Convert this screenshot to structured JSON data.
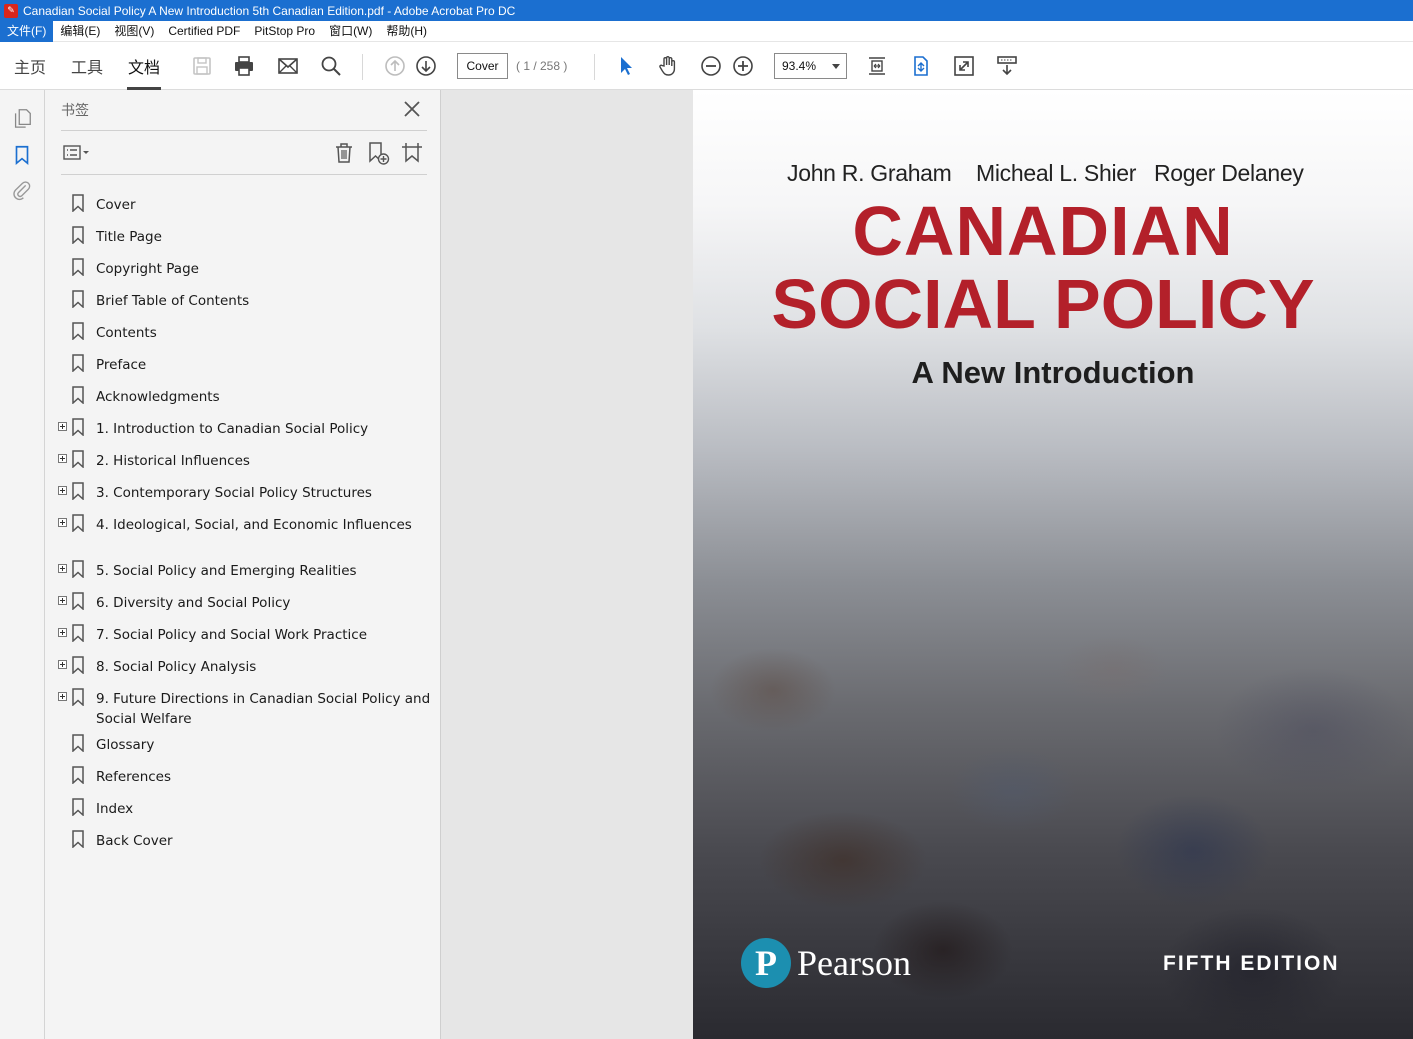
{
  "window": {
    "title": "Canadian Social Policy A New Introduction 5th Canadian Edition.pdf - Adobe Acrobat Pro DC",
    "app_icon": "pdf-icon"
  },
  "menubar": {
    "items": [
      "文件(F)",
      "编辑(E)",
      "视图(V)",
      "Certified PDF",
      "PitStop Pro",
      "窗口(W)",
      "帮助(H)"
    ]
  },
  "toolbar": {
    "tabs": [
      "主页",
      "工具",
      "文档"
    ],
    "selected_tab": "文档",
    "page_input": "Cover",
    "page_count": "( 1 / 258 )",
    "zoom": "93.4%",
    "icons": [
      "save-icon",
      "print-icon",
      "email-icon",
      "search-icon",
      "page-up-icon",
      "page-down-icon",
      "select-pointer-icon",
      "hand-tool-icon",
      "zoom-out-icon",
      "zoom-in-icon",
      "fit-page-icon",
      "scroll-mode-icon",
      "fullscreen-icon",
      "read-mode-icon"
    ]
  },
  "left_rail": {
    "icons": [
      "pages-icon",
      "bookmark-icon",
      "attachment-icon"
    ]
  },
  "bookmarks": {
    "header": "书签",
    "items": [
      {
        "label": "Cover",
        "expandable": false
      },
      {
        "label": "Title Page",
        "expandable": false
      },
      {
        "label": "Copyright Page",
        "expandable": false
      },
      {
        "label": "Brief Table of Contents",
        "expandable": false
      },
      {
        "label": "Contents",
        "expandable": false
      },
      {
        "label": "Preface",
        "expandable": false
      },
      {
        "label": "Acknowledgments",
        "expandable": false
      },
      {
        "label": "1. Introduction to Canadian Social Policy",
        "expandable": true
      },
      {
        "label": "2. Historical Influences",
        "expandable": true
      },
      {
        "label": "3. Contemporary Social Policy Structures",
        "expandable": true
      },
      {
        "label": "4. Ideological, Social, and Economic Influences",
        "expandable": true
      },
      {
        "label": "5. Social Policy and Emerging Realities",
        "expandable": true
      },
      {
        "label": "6. Diversity and Social Policy",
        "expandable": true
      },
      {
        "label": "7. Social Policy and Social Work Practice",
        "expandable": true
      },
      {
        "label": "8. Social Policy Analysis",
        "expandable": true
      },
      {
        "label": "9. Future Directions in Canadian Social Policy and Social Welfare",
        "expandable": true
      },
      {
        "label": "Glossary",
        "expandable": false
      },
      {
        "label": "References",
        "expandable": false
      },
      {
        "label": "Index",
        "expandable": false
      },
      {
        "label": "Back Cover",
        "expandable": false
      }
    ]
  },
  "cover": {
    "authors": [
      "John R. Graham",
      "Micheal L. Shier",
      "Roger Delaney"
    ],
    "title_line1": "CANADIAN",
    "title_line2": "SOCIAL POLICY",
    "subtitle": "A New Introduction",
    "publisher_logo_letter": "P",
    "publisher": "Pearson",
    "edition": "FIFTH EDITION",
    "colors": {
      "title": "#b3202a",
      "logo": "#1c8fb0"
    }
  }
}
